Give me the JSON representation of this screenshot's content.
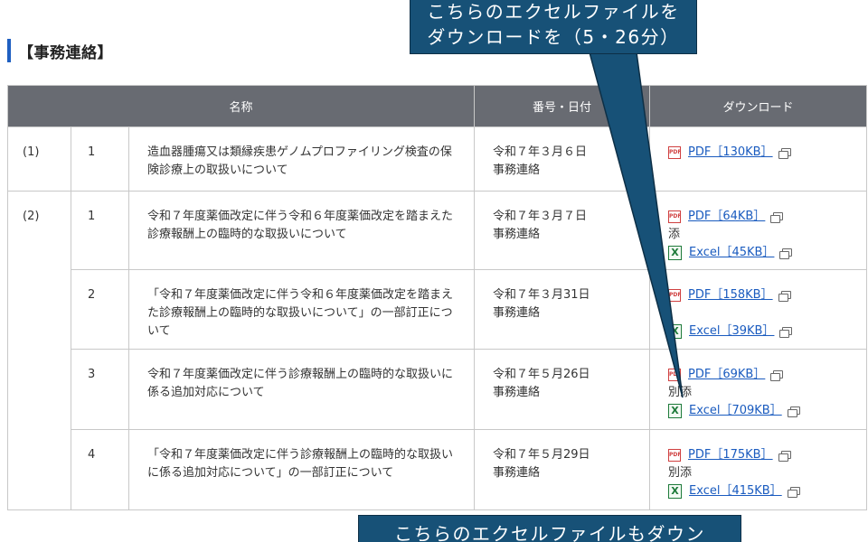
{
  "section": {
    "title": "【事務連絡】"
  },
  "table": {
    "headers": {
      "name": "名称",
      "date": "番号・日付",
      "download": "ダウンロード"
    },
    "groups": [
      {
        "label": "(1)",
        "rows": [
          {
            "num": "1",
            "name": "造血器腫瘍又は類縁疾患ゲノムプロファイリング検査の保険診療上の取扱いについて",
            "date": "令和７年３月６日",
            "type": "事務連絡",
            "pdf": "PDF［130KB］",
            "attach_label": "",
            "excel": ""
          }
        ]
      },
      {
        "label": "(2)",
        "rows": [
          {
            "num": "1",
            "name": "令和７年度薬価改定に伴う令和６年度薬価改定を踏まえた診療報酬上の臨時的な取扱いについて",
            "date": "令和７年３月７日",
            "type": "事務連絡",
            "pdf": "PDF［64KB］",
            "attach_label": "添",
            "excel": "Excel［45KB］"
          },
          {
            "num": "2",
            "name": "「令和７年度薬価改定に伴う令和６年度薬価改定を踏まえた診療報酬上の臨時的な取扱いについて」の一部訂正について",
            "date": "令和７年３月31日",
            "type": "事務連絡",
            "pdf": "PDF［158KB］",
            "attach_label": "",
            "excel": "Excel［39KB］"
          },
          {
            "num": "3",
            "name": "令和７年度薬価改定に伴う診療報酬上の臨時的な取扱いに係る追加対応について",
            "date": "令和７年５月26日",
            "type": "事務連絡",
            "pdf": "PDF［69KB］",
            "attach_label": "別添",
            "excel": "Excel［709KB］"
          },
          {
            "num": "4",
            "name": "「令和７年度薬価改定に伴う診療報酬上の臨時的な取扱いに係る追加対応について」の一部訂正について",
            "date": "令和７年５月29日",
            "type": "事務連絡",
            "pdf": "PDF［175KB］",
            "attach_label": "別添",
            "excel": "Excel［415KB］"
          }
        ]
      }
    ]
  },
  "callouts": {
    "top_line1": "こちらのエクセルファイルを",
    "top_line2": "ダウンロードを（5・26分）",
    "bottom_line1": "こちらのエクセルファイルもダウン"
  },
  "icons": {
    "pdf": "pdf-icon",
    "excel": "excel-icon",
    "external": "external-window-icon"
  },
  "colors": {
    "header_bg": "#686b72",
    "link": "#1a5bbf",
    "callout_bg": "#175177",
    "heading_bar": "#1f5fc1"
  }
}
